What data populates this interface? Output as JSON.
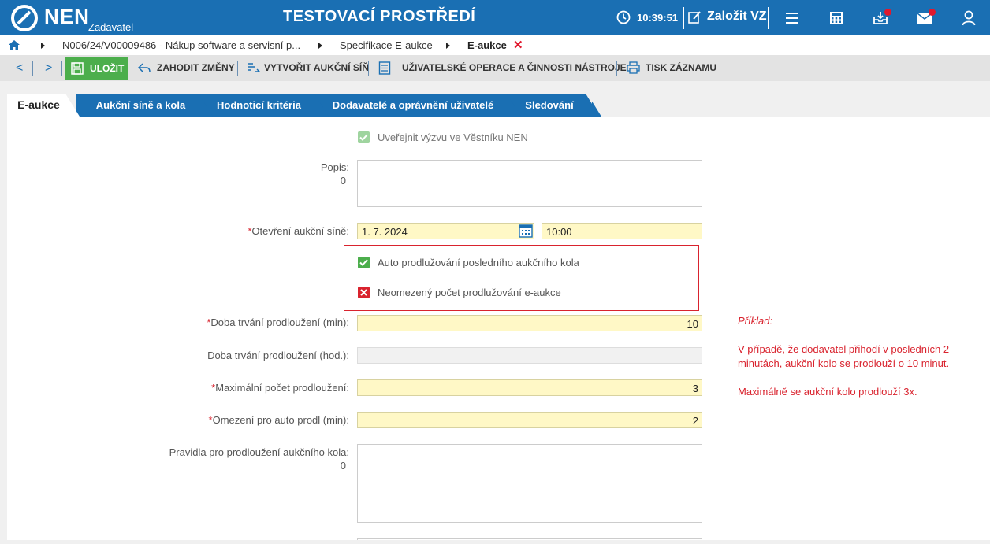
{
  "header": {
    "logo": "NEN",
    "role": "Zadavatel",
    "environment": "TESTOVACÍ PROSTŘEDÍ",
    "time": "10:39:51",
    "new_vz": "Založit VZ",
    "icons": [
      "menu-icon",
      "calculator-icon",
      "inbox-icon",
      "mail-icon",
      "user-icon"
    ],
    "colors": {
      "bar": "#1a6fb3",
      "badge": "#e0182d"
    }
  },
  "breadcrumb": {
    "items": [
      "N006/24/V00009486 - Nákup software a servisní p...",
      "Specifikace E-aukce",
      "E-aukce"
    ]
  },
  "toolbar": {
    "save": "ULOŽIT",
    "discard": "ZAHODIT ZMĚNY",
    "create_room": "VYTVOŘIT AUKČNÍ SÍŇ",
    "user_ops": "UŽIVATELSKÉ OPERACE A ČINNOSTI NÁSTROJE",
    "print": "TISK ZÁZNAMU"
  },
  "tabs": [
    "E-aukce",
    "Aukční síně a kola",
    "Hodnoticí kritéria",
    "Dodavatelé a oprávnění uživatelé",
    "Sledování"
  ],
  "form": {
    "publish_label": "Uveřejnit výzvu ve Věstníku NEN",
    "popis_label": "Popis:",
    "popis_count": "0",
    "opening_label": "Otevření aukční síně:",
    "opening_date": "1. 7. 2024",
    "opening_time": "10:00",
    "auto_extend_label": "Auto prodlužování posledního aukčního kola",
    "unlimited_label": "Neomezený počet prodlužování e-aukce",
    "duration_min_label": "Doba trvání prodloužení (min):",
    "duration_min_value": "10",
    "duration_hod_label": "Doba trvání prodloužení (hod.):",
    "max_count_label": "Maximální počet prodloužení:",
    "max_count_value": "3",
    "limit_label": "Omezení pro auto prodl (min):",
    "limit_value": "2",
    "rules_label": "Pravidla pro prodloužení aukčního kola:",
    "rules_count": "0"
  },
  "note": {
    "title": "Příklad:",
    "line1": "V případě, že dodavatel přihodí v posledních 2",
    "line2": "minutách, aukční kolo se prodlouží o 10 minut.",
    "line3": "Maximálně se aukční kolo prodlouží 3x."
  }
}
